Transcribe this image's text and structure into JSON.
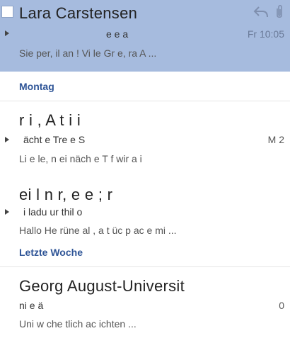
{
  "mails": [
    {
      "sender": "Lara Carstensen",
      "subject": "e e a",
      "time": "Fr 10:05",
      "preview": "Sie per, il an ! Vi le Gr e, ra A ..."
    },
    {
      "sender": "r i , A t i i",
      "subject": "ächt e Tre e S",
      "time": "M 2",
      "preview": "Li e le, n ei näch e T f wir a i"
    },
    {
      "sender": "ei l n r, e e ; r",
      "subject": "i ladu ur thil o",
      "time": "",
      "preview": "Hallo He rüne al , a t üc p ac e mi ..."
    },
    {
      "sender": "Georg August-Universit",
      "subject": "ni e ä",
      "time": "0",
      "preview": "Uni w che tlich ac ichten ..."
    }
  ],
  "groups": {
    "montag": "Montag",
    "letzte_woche": "Letzte Woche"
  },
  "icons": {
    "reply": "reply-icon",
    "attachment": "paperclip-icon"
  }
}
